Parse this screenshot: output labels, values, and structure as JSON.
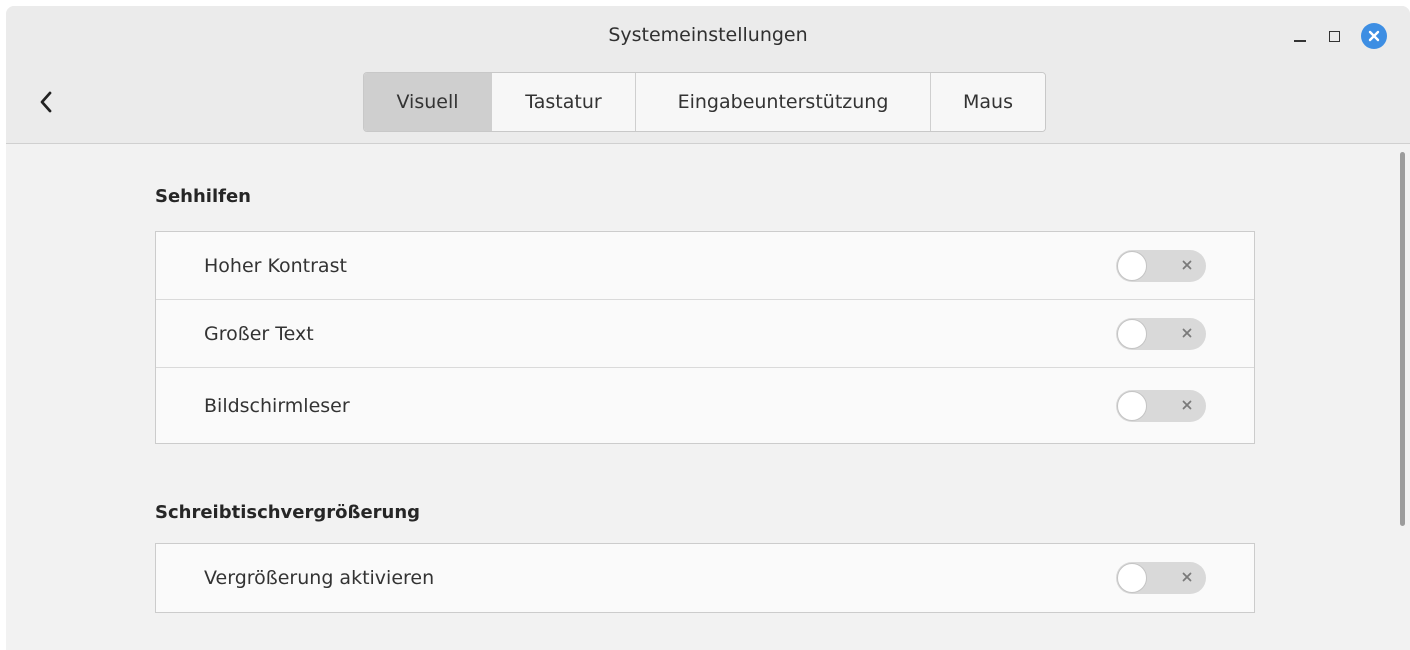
{
  "window": {
    "title": "Systemeinstellungen"
  },
  "tabs": [
    {
      "label": "Visuell",
      "active": true
    },
    {
      "label": "Tastatur",
      "active": false
    },
    {
      "label": "Eingabeunterstützung",
      "active": false
    },
    {
      "label": "Maus",
      "active": false
    }
  ],
  "sections": [
    {
      "title": "Sehhilfen",
      "items": [
        {
          "label": "Hoher Kontrast",
          "enabled": false
        },
        {
          "label": "Großer Text",
          "enabled": false
        },
        {
          "label": "Bildschirmleser",
          "enabled": false
        }
      ]
    },
    {
      "title": "Schreibtischvergrößerung",
      "items": [
        {
          "label": "Vergrößerung aktivieren",
          "enabled": false
        }
      ]
    }
  ],
  "icons": {
    "back": "chevron-left-icon",
    "minimize": "minimize-icon",
    "maximize": "maximize-icon",
    "close": "close-icon",
    "switch_off": "x-icon"
  },
  "colors": {
    "close_button": "#3d8ee3",
    "active_tab": "#cfcfcf",
    "switch_track": "#d9d9d9"
  }
}
